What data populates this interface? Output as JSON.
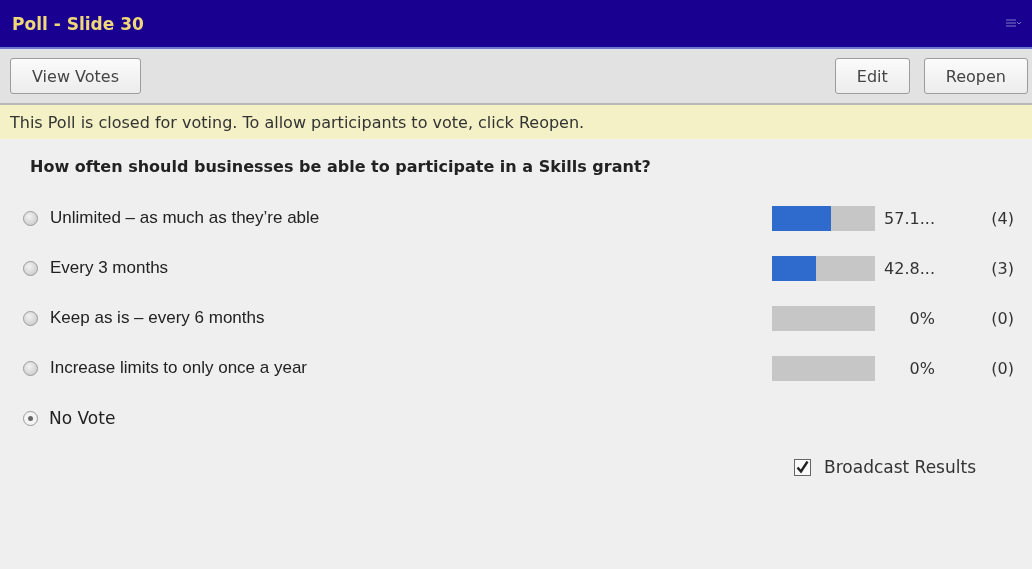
{
  "window": {
    "title": "Poll - Slide 30"
  },
  "toolbar": {
    "left_buttons": [
      "View Votes"
    ],
    "right_buttons": [
      "Edit",
      "Reopen"
    ]
  },
  "notice": "This Poll is closed for voting. To allow participants to vote, click Reopen.",
  "question": "How often should businesses be able to participate in a Skills grant?",
  "options": [
    {
      "kind": "answer",
      "label": "Unlimited – as much as they’re able",
      "selected": false,
      "level": 0.571,
      "percent": "57.1...",
      "count": "(4)"
    },
    {
      "kind": "answer",
      "label": "Every 3 months",
      "selected": false,
      "level": 0.428,
      "percent": "42.8...",
      "count": "(3)"
    },
    {
      "kind": "answer",
      "label": "Keep as is – every 6 months",
      "selected": false,
      "percent": "0%",
      "count": "(0)"
    },
    {
      "kind": "answer",
      "label": "Increase limits to only once a year",
      "selected": false,
      "percent": "0%",
      "count": "(0)"
    },
    {
      "kind": "novote",
      "label": "No Vote",
      "selected": true
    }
  ],
  "broadcast": {
    "label": "Broadcast Results",
    "checked": true
  }
}
